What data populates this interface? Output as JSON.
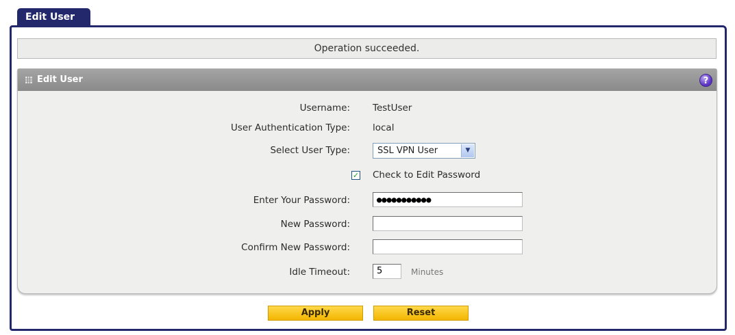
{
  "tab": {
    "label": "Edit User"
  },
  "status": {
    "message": "Operation succeeded."
  },
  "panel": {
    "title": "Edit User",
    "help": "?"
  },
  "form": {
    "username": {
      "label": "Username:",
      "value": "TestUser"
    },
    "auth_type": {
      "label": "User Authentication Type:",
      "value": "local"
    },
    "user_type": {
      "label": "Select User Type:",
      "selected": "SSL VPN User"
    },
    "edit_password": {
      "label": "Check to Edit Password",
      "checked": true
    },
    "current_password": {
      "label": "Enter Your Password:",
      "value": "●●●●●●●●●●●"
    },
    "new_password": {
      "label": "New Password:",
      "value": ""
    },
    "confirm_password": {
      "label": "Confirm New Password:",
      "value": ""
    },
    "idle_timeout": {
      "label": "Idle Timeout:",
      "value": "5",
      "unit": "Minutes"
    }
  },
  "buttons": {
    "apply": "Apply",
    "reset": "Reset"
  },
  "colors": {
    "tab_bg": "#22286b",
    "header_bg": "#999999",
    "button_bg": "#f7c51a",
    "help_icon": "#5c33c4"
  }
}
